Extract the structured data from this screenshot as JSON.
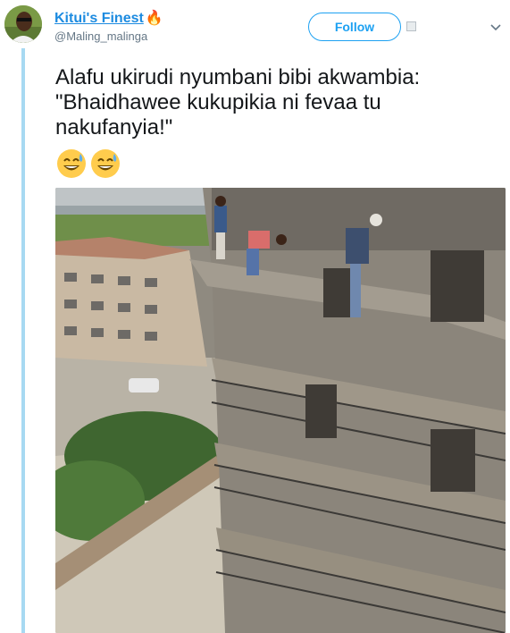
{
  "tweet": {
    "author_name": "Kitui's Finest",
    "author_emoji": "🔥",
    "handle": "@Maling_malinga",
    "follow_label": "Follow",
    "text_lines": [
      "Alafu ukirudi nyumbani bibi akwambia:",
      "\"Bhaidhawee kukupikia ni fevaa tu",
      "nakufanyia!\""
    ],
    "emoji_names": [
      "grinning-face-with-sweat-icon",
      "grinning-face-with-sweat-icon"
    ]
  },
  "icons": {
    "more": "chevron-down-icon",
    "embed": "media-icon"
  },
  "colors": {
    "brand": "#1da1f2",
    "link": "#1d8be0",
    "thread_line": "#a7d9f2",
    "muted": "#657786"
  }
}
